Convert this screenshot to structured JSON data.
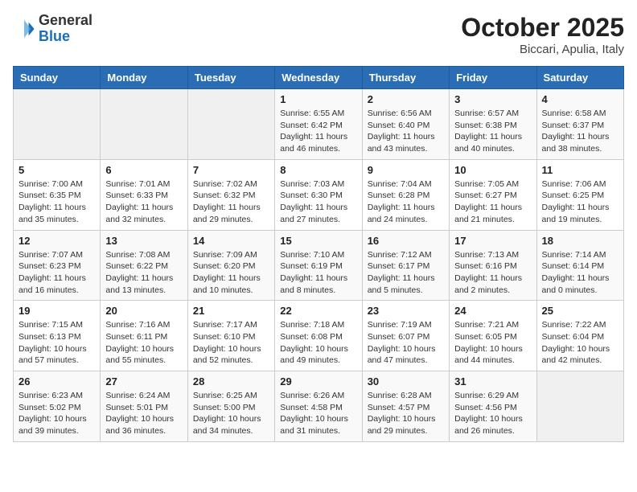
{
  "header": {
    "logo_general": "General",
    "logo_blue": "Blue",
    "month_year": "October 2025",
    "location": "Biccari, Apulia, Italy"
  },
  "days_of_week": [
    "Sunday",
    "Monday",
    "Tuesday",
    "Wednesday",
    "Thursday",
    "Friday",
    "Saturday"
  ],
  "weeks": [
    [
      {
        "day": "",
        "info": ""
      },
      {
        "day": "",
        "info": ""
      },
      {
        "day": "",
        "info": ""
      },
      {
        "day": "1",
        "info": "Sunrise: 6:55 AM\nSunset: 6:42 PM\nDaylight: 11 hours and 46 minutes."
      },
      {
        "day": "2",
        "info": "Sunrise: 6:56 AM\nSunset: 6:40 PM\nDaylight: 11 hours and 43 minutes."
      },
      {
        "day": "3",
        "info": "Sunrise: 6:57 AM\nSunset: 6:38 PM\nDaylight: 11 hours and 40 minutes."
      },
      {
        "day": "4",
        "info": "Sunrise: 6:58 AM\nSunset: 6:37 PM\nDaylight: 11 hours and 38 minutes."
      }
    ],
    [
      {
        "day": "5",
        "info": "Sunrise: 7:00 AM\nSunset: 6:35 PM\nDaylight: 11 hours and 35 minutes."
      },
      {
        "day": "6",
        "info": "Sunrise: 7:01 AM\nSunset: 6:33 PM\nDaylight: 11 hours and 32 minutes."
      },
      {
        "day": "7",
        "info": "Sunrise: 7:02 AM\nSunset: 6:32 PM\nDaylight: 11 hours and 29 minutes."
      },
      {
        "day": "8",
        "info": "Sunrise: 7:03 AM\nSunset: 6:30 PM\nDaylight: 11 hours and 27 minutes."
      },
      {
        "day": "9",
        "info": "Sunrise: 7:04 AM\nSunset: 6:28 PM\nDaylight: 11 hours and 24 minutes."
      },
      {
        "day": "10",
        "info": "Sunrise: 7:05 AM\nSunset: 6:27 PM\nDaylight: 11 hours and 21 minutes."
      },
      {
        "day": "11",
        "info": "Sunrise: 7:06 AM\nSunset: 6:25 PM\nDaylight: 11 hours and 19 minutes."
      }
    ],
    [
      {
        "day": "12",
        "info": "Sunrise: 7:07 AM\nSunset: 6:23 PM\nDaylight: 11 hours and 16 minutes."
      },
      {
        "day": "13",
        "info": "Sunrise: 7:08 AM\nSunset: 6:22 PM\nDaylight: 11 hours and 13 minutes."
      },
      {
        "day": "14",
        "info": "Sunrise: 7:09 AM\nSunset: 6:20 PM\nDaylight: 11 hours and 10 minutes."
      },
      {
        "day": "15",
        "info": "Sunrise: 7:10 AM\nSunset: 6:19 PM\nDaylight: 11 hours and 8 minutes."
      },
      {
        "day": "16",
        "info": "Sunrise: 7:12 AM\nSunset: 6:17 PM\nDaylight: 11 hours and 5 minutes."
      },
      {
        "day": "17",
        "info": "Sunrise: 7:13 AM\nSunset: 6:16 PM\nDaylight: 11 hours and 2 minutes."
      },
      {
        "day": "18",
        "info": "Sunrise: 7:14 AM\nSunset: 6:14 PM\nDaylight: 11 hours and 0 minutes."
      }
    ],
    [
      {
        "day": "19",
        "info": "Sunrise: 7:15 AM\nSunset: 6:13 PM\nDaylight: 10 hours and 57 minutes."
      },
      {
        "day": "20",
        "info": "Sunrise: 7:16 AM\nSunset: 6:11 PM\nDaylight: 10 hours and 55 minutes."
      },
      {
        "day": "21",
        "info": "Sunrise: 7:17 AM\nSunset: 6:10 PM\nDaylight: 10 hours and 52 minutes."
      },
      {
        "day": "22",
        "info": "Sunrise: 7:18 AM\nSunset: 6:08 PM\nDaylight: 10 hours and 49 minutes."
      },
      {
        "day": "23",
        "info": "Sunrise: 7:19 AM\nSunset: 6:07 PM\nDaylight: 10 hours and 47 minutes."
      },
      {
        "day": "24",
        "info": "Sunrise: 7:21 AM\nSunset: 6:05 PM\nDaylight: 10 hours and 44 minutes."
      },
      {
        "day": "25",
        "info": "Sunrise: 7:22 AM\nSunset: 6:04 PM\nDaylight: 10 hours and 42 minutes."
      }
    ],
    [
      {
        "day": "26",
        "info": "Sunrise: 6:23 AM\nSunset: 5:02 PM\nDaylight: 10 hours and 39 minutes."
      },
      {
        "day": "27",
        "info": "Sunrise: 6:24 AM\nSunset: 5:01 PM\nDaylight: 10 hours and 36 minutes."
      },
      {
        "day": "28",
        "info": "Sunrise: 6:25 AM\nSunset: 5:00 PM\nDaylight: 10 hours and 34 minutes."
      },
      {
        "day": "29",
        "info": "Sunrise: 6:26 AM\nSunset: 4:58 PM\nDaylight: 10 hours and 31 minutes."
      },
      {
        "day": "30",
        "info": "Sunrise: 6:28 AM\nSunset: 4:57 PM\nDaylight: 10 hours and 29 minutes."
      },
      {
        "day": "31",
        "info": "Sunrise: 6:29 AM\nSunset: 4:56 PM\nDaylight: 10 hours and 26 minutes."
      },
      {
        "day": "",
        "info": ""
      }
    ]
  ]
}
